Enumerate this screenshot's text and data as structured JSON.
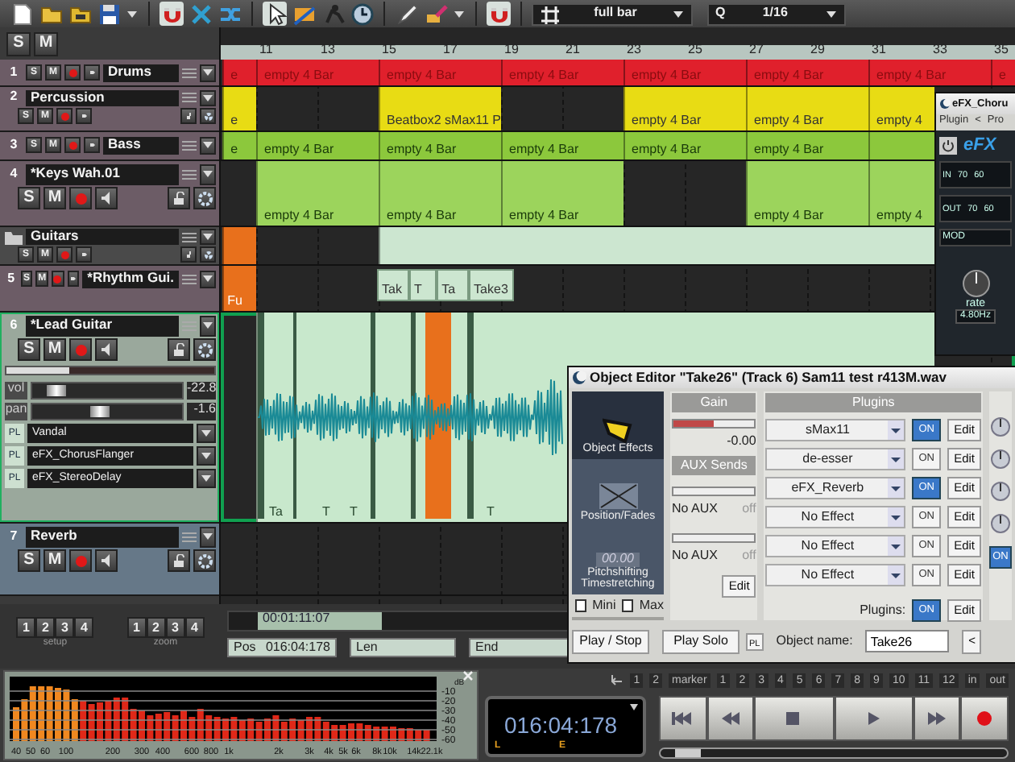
{
  "toolbar": {
    "tools": [
      {
        "kind": "pointer",
        "selected": true
      },
      {
        "kind": "range",
        "selected": false
      },
      {
        "kind": "draw",
        "selected": false
      },
      {
        "kind": "paint",
        "selected": false
      }
    ],
    "grid": {
      "value": "full bar"
    },
    "quantize": {
      "label": "Q",
      "value": "1/16"
    }
  },
  "header": {
    "buttons": [
      "S",
      "M"
    ]
  },
  "ruler": {
    "bars": [
      "11",
      "13",
      "15",
      "17",
      "19",
      "21",
      "23",
      "25",
      "27",
      "29",
      "31",
      "33",
      "35"
    ]
  },
  "tracks": [
    {
      "number": "1",
      "name": "Drums",
      "kind": "compact",
      "selected": false,
      "buttons": [
        "S",
        "M"
      ],
      "clips": [
        {
          "label": "e",
          "color": "#e0202c"
        },
        {
          "label": "empty 4 Bar",
          "color": "#e0202c"
        },
        {
          "label": "empty 4 Bar",
          "color": "#e0202c"
        },
        {
          "label": "empty 4 Bar",
          "color": "#e0202c"
        },
        {
          "label": "empty 4 Bar",
          "color": "#e0202c"
        },
        {
          "label": "empty 4 Bar",
          "color": "#e0202c"
        },
        {
          "label": "empty 4 Bar",
          "color": "#e0202c"
        },
        {
          "label": "e",
          "color": "#e0202c"
        }
      ]
    },
    {
      "number": "2",
      "name": "Percussion",
      "kind": "expanded",
      "selected": false,
      "buttons": [
        "S",
        "M"
      ],
      "clips": [
        {
          "label": "e",
          "color": "#e8dc14"
        },
        {
          "label": "Beatbox2 sMax11 P",
          "color": "#e8dc14"
        },
        {
          "label": "empty 4 Bar",
          "color": "#e8dc14"
        },
        {
          "label": "empty 4 Bar",
          "color": "#e8dc14"
        },
        {
          "label": "empty 4",
          "color": "#e8dc14"
        }
      ]
    },
    {
      "number": "3",
      "name": "Bass",
      "kind": "compact",
      "selected": false,
      "buttons": [
        "S",
        "M"
      ],
      "clips": [
        {
          "label": "e",
          "color": "#8cc83c"
        },
        {
          "label": "empty 4 Bar",
          "color": "#8cc83c"
        },
        {
          "label": "empty 4 Bar",
          "color": "#8cc83c"
        },
        {
          "label": "empty 4 Bar",
          "color": "#8cc83c"
        },
        {
          "label": "empty 4 Bar",
          "color": "#8cc83c"
        },
        {
          "label": "empty 4 Bar",
          "color": "#8cc83c"
        },
        {
          "color": "#8cc83c"
        }
      ]
    },
    {
      "number": "4",
      "name": "*Keys Wah.01",
      "kind": "large",
      "selected": false,
      "buttons": [
        "S",
        "M"
      ],
      "clips": [
        {
          "label": "empty 4 Bar",
          "color": "#9cd45c"
        },
        {
          "label": "empty 4 Bar",
          "color": "#9cd45c"
        },
        {
          "label": "empty 4 Bar",
          "color": "#9cd45c"
        },
        {
          "label": "empty 4 Bar",
          "color": "#9cd45c"
        },
        {
          "label": "empty 4",
          "color": "#9cd45c"
        }
      ]
    },
    {
      "name": "Guitars",
      "kind": "folder",
      "selected": false,
      "buttons": [
        "S",
        "M"
      ],
      "clips": [
        {
          "color": "#e8701c"
        },
        {
          "color": "#cce6d0"
        }
      ]
    },
    {
      "number": "5",
      "name": "*Rhythm Gui.",
      "kind": "compact",
      "selected": false,
      "buttons": [
        "S",
        "M"
      ],
      "clips": [
        {
          "label": "Fu",
          "color": "#e8701c"
        },
        {
          "label": "Tak",
          "color": "#cce6d0"
        },
        {
          "label": "T",
          "color": "#cce6d0"
        },
        {
          "label": "Ta",
          "color": "#cce6d0"
        },
        {
          "label": "Take3",
          "color": "#cce6d0"
        }
      ]
    },
    {
      "number": "6",
      "name": "*Lead Guitar",
      "kind": "full",
      "selected": true,
      "buttons": [
        "S",
        "M"
      ],
      "meter": {
        "level": 0.3
      },
      "vol": {
        "label": "vol",
        "value": "-22.8",
        "level": 0.12
      },
      "pan": {
        "label": "pan",
        "value": "-1.6",
        "level": 0.45
      },
      "plugins": [
        {
          "tag": "PL",
          "name": "Vandal"
        },
        {
          "tag": "PL",
          "name": "eFX_ChorusFlanger"
        },
        {
          "tag": "PL",
          "name": "eFX_StereoDelay"
        }
      ],
      "clips": [
        {
          "color": "#c8e8cc"
        }
      ],
      "markers": [
        "Ta",
        "T",
        "T",
        "T"
      ]
    },
    {
      "number": "7",
      "name": "Reverb",
      "kind": "aux",
      "selected": false,
      "buttons": [
        "S",
        "M"
      ]
    }
  ],
  "setup": {
    "buttons": [
      "1",
      "2",
      "3",
      "4"
    ],
    "label": "setup"
  },
  "zoom": {
    "buttons": [
      "1",
      "2",
      "3",
      "4"
    ],
    "label": "zoom"
  },
  "scroll": {
    "time": "00:01:11:07"
  },
  "position": {
    "pos_label": "Pos",
    "pos": "016:04:178",
    "len_label": "Len",
    "end_label": "End"
  },
  "analyzer": {
    "x_labels": [
      "40",
      "50",
      "60",
      "100",
      "200",
      "300",
      "400",
      "600",
      "800",
      "1k",
      "2k",
      "3k",
      "4k",
      "5k",
      "6k",
      "8k",
      "10k",
      "14k",
      "22.1k"
    ],
    "y_labels": [
      "-10",
      "-20",
      "-30",
      "-40",
      "-50",
      "-60"
    ],
    "unit": "dB"
  },
  "transport": {
    "markers": [
      "1",
      "2",
      "marker",
      "1",
      "2",
      "3",
      "4",
      "5",
      "6",
      "7",
      "8",
      "9",
      "10",
      "11",
      "12",
      "in",
      "out"
    ],
    "time": "016:04:178",
    "flags": [
      "L",
      "E"
    ],
    "slider": {
      "level": 0.04
    }
  },
  "object_editor": {
    "title": "Object Editor \"Take26\"  (Track 6)  Sam11 test r413M.wav",
    "sections": [
      {
        "label": "Object Effects",
        "kind": "effects",
        "selected": true
      },
      {
        "label": "Position/Fades",
        "kind": "fades",
        "selected": false
      },
      {
        "label": "Pitchshifting Timestretching",
        "kind": "pitch",
        "selected": false,
        "display": "00.00"
      }
    ],
    "options": [
      {
        "label": "Mini",
        "checked": false
      },
      {
        "label": "Max",
        "checked": false
      }
    ],
    "gain": {
      "title": "Gain",
      "level": 0.5,
      "value": "-0.00"
    },
    "aux": {
      "title": "AUX Sends",
      "sends": [
        {
          "label": "No AUX",
          "state": "off"
        },
        {
          "label": "No AUX",
          "state": "off"
        }
      ],
      "edit": "Edit"
    },
    "plugins": {
      "title": "Plugins",
      "rows": [
        {
          "name": "sMax11",
          "on": true,
          "toggle": "ON",
          "edit": "Edit"
        },
        {
          "name": "de-esser",
          "on": false,
          "toggle": "ON",
          "edit": "Edit"
        },
        {
          "name": "eFX_Reverb",
          "on": true,
          "toggle": "ON",
          "edit": "Edit"
        },
        {
          "name": "No Effect",
          "on": false,
          "toggle": "ON",
          "edit": "Edit"
        },
        {
          "name": "No Effect",
          "on": false,
          "toggle": "ON",
          "edit": "Edit"
        },
        {
          "name": "No Effect",
          "on": false,
          "toggle": "ON",
          "edit": "Edit"
        }
      ],
      "footer": {
        "label": "Plugins:",
        "on": true,
        "toggle": "ON",
        "edit": "Edit"
      }
    },
    "side": {
      "toggle": "ON",
      "on": true
    },
    "play_stop": "Play / Stop",
    "play_solo": "Play Solo",
    "pl": "PL",
    "name_label": "Object name:",
    "name_value": "Take26",
    "back": "<"
  },
  "efx": {
    "title": "eFX_Choru",
    "menu": [
      "Plugin",
      "<",
      "Pro"
    ],
    "logo": "eFX",
    "meters": [
      {
        "label": "IN",
        "scale": [
          "70",
          "60"
        ]
      },
      {
        "label": "OUT",
        "scale": [
          "70",
          "60"
        ]
      }
    ],
    "mod": "MOD",
    "knob_label": "rate",
    "knob_value": "4.80Hz"
  }
}
